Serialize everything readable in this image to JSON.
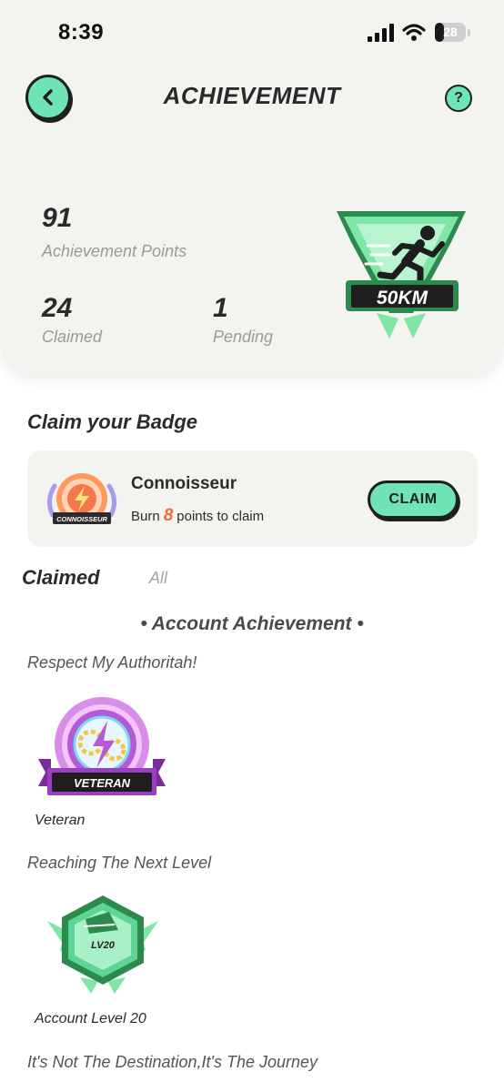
{
  "status_bar": {
    "time": "8:39",
    "battery": "28",
    "battery_level": 0.28
  },
  "header": {
    "title": "ACHIEVEMENT",
    "help_label": "?"
  },
  "summary": {
    "points_value": "91",
    "points_label": "Achievement Points",
    "claimed_value": "24",
    "claimed_label": "Claimed",
    "pending_value": "1",
    "pending_label": "Pending",
    "featured_badge_text": "50KM"
  },
  "claim_section": {
    "title": "Claim your Badge",
    "badge_ribbon": "CONNOISSEUR",
    "badge_name": "Connoisseur",
    "desc_prefix": "Burn",
    "desc_points": "8",
    "desc_suffix": "points to claim",
    "button_label": "CLAIM"
  },
  "tabs": {
    "claimed": "Claimed",
    "all": "All"
  },
  "group_title": "• Account Achievement •",
  "categories": [
    {
      "title": "Respect My Authoritah!",
      "badge_ribbon": "VETERAN",
      "badge_name": "Veteran"
    },
    {
      "title": "Reaching The Next Level",
      "badge_ribbon": "LV20",
      "badge_name": "Account Level 20"
    },
    {
      "title": "It's Not The Destination,It's The Journey"
    }
  ],
  "colors": {
    "accent": "#6fe5b6",
    "points_highlight": "#f06b3c",
    "card_bg": "#f3f3ef"
  }
}
